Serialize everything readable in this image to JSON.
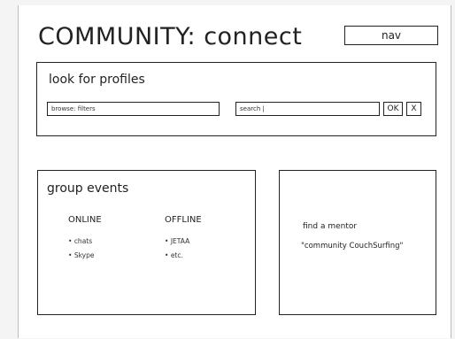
{
  "header": {
    "title": "COMMUNITY: connect",
    "nav_label": "nav"
  },
  "profile_search": {
    "title": "look for profiles",
    "browse_value": "browse: filters",
    "search_value": "search |",
    "ok_label": "OK",
    "clear_label": "X"
  },
  "group_events": {
    "title": "group events",
    "online": {
      "heading": "ONLINE",
      "items": [
        "chats",
        "Skype"
      ]
    },
    "offline": {
      "heading": "OFFLINE",
      "items": [
        "JETAA",
        "etc."
      ]
    }
  },
  "mentor": {
    "line1": "find a mentor",
    "line2": "\"community CouchSurfing\""
  }
}
